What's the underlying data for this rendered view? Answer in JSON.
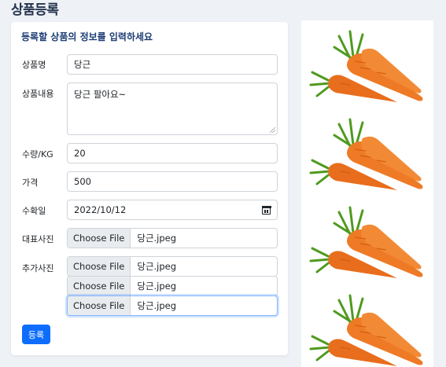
{
  "page": {
    "title": "상품등록"
  },
  "form": {
    "heading": "등록할 상품의 정보를 입력하세요",
    "name": {
      "label": "상품명",
      "value": "당근"
    },
    "description": {
      "label": "상품내용",
      "value": "당근 팔아요~"
    },
    "quantity": {
      "label": "수량/KG",
      "value": "20"
    },
    "price": {
      "label": "가격",
      "value": "500"
    },
    "harvest_date": {
      "label": "수확일",
      "value": "2022/10/12"
    },
    "main_photo": {
      "label": "대표사진",
      "button": "Choose File",
      "filename": "당근.jpeg"
    },
    "extra_photos": {
      "label": "추가사진",
      "files": [
        {
          "button": "Choose File",
          "filename": "당근.jpeg"
        },
        {
          "button": "Choose File",
          "filename": "당근.jpeg"
        },
        {
          "button": "Choose File",
          "filename": "당근.jpeg"
        }
      ]
    },
    "submit_label": "등록"
  },
  "preview": {
    "images": [
      "carrot-image",
      "carrot-image",
      "carrot-image",
      "carrot-image"
    ],
    "colors": {
      "carrot": "#ef7a26",
      "carrot_shadow": "#d35f12",
      "leaf": "#4f9a1f",
      "leaf_light": "#76b83a"
    }
  },
  "colors": {
    "accent": "#0d6efd",
    "heading": "#1c3d74",
    "background": "#eef2f7"
  }
}
